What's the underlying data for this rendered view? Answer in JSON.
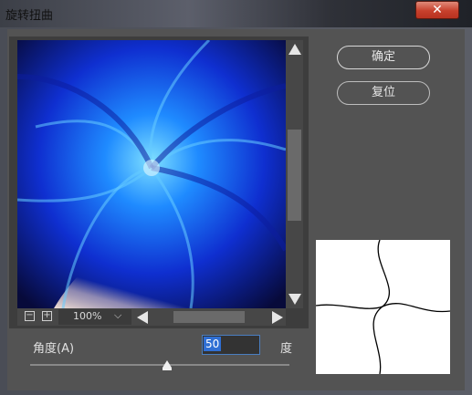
{
  "window": {
    "title": "旋转扭曲",
    "close_glyph": "✕"
  },
  "buttons": {
    "ok": "确定",
    "reset": "复位"
  },
  "preview": {
    "zoom": "100%",
    "zoom_out_glyph": "−",
    "zoom_in_glyph": "+",
    "chevron": "⌵"
  },
  "angle": {
    "label": "角度(A)",
    "value": "50",
    "unit": "度",
    "slider_level": 50
  },
  "colors": {
    "accent": "#2f6fd4",
    "close": "#c7402c",
    "swirl": "#1e7bff"
  }
}
